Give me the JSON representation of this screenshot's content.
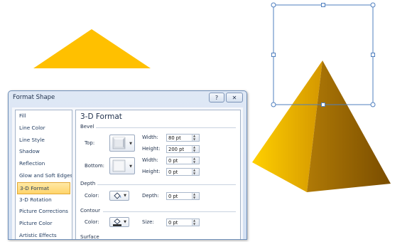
{
  "dialog": {
    "title": "Format Shape",
    "help_label": "?",
    "close_label": "✕",
    "categories": [
      {
        "label": "Fill"
      },
      {
        "label": "Line Color"
      },
      {
        "label": "Line Style"
      },
      {
        "label": "Shadow"
      },
      {
        "label": "Reflection"
      },
      {
        "label": "Glow and Soft Edges"
      },
      {
        "label": "3-D Format",
        "selected": true
      },
      {
        "label": "3-D Rotation"
      },
      {
        "label": "Picture Corrections"
      },
      {
        "label": "Picture Color"
      },
      {
        "label": "Artistic Effects"
      }
    ],
    "panel": {
      "title": "3-D Format",
      "bevel": {
        "label": "Bevel",
        "top_label": "Top:",
        "bottom_label": "Bottom:",
        "width_label": "Width:",
        "height_label": "Height:",
        "top_width": "80 pt",
        "top_height": "200 pt",
        "bottom_width": "0 pt",
        "bottom_height": "0 pt"
      },
      "depth": {
        "label": "Depth",
        "color_label": "Color:",
        "depth_label": "Depth:",
        "depth_value": "0 pt"
      },
      "contour": {
        "label": "Contour",
        "color_label": "Color:",
        "size_label": "Size:",
        "size_value": "0 pt"
      },
      "surface": {
        "label": "Surface"
      }
    }
  },
  "colors": {
    "shape_fill": "#ffc000",
    "selection_outline": "#4f7fbf",
    "selected_category": "#ffd46a"
  }
}
